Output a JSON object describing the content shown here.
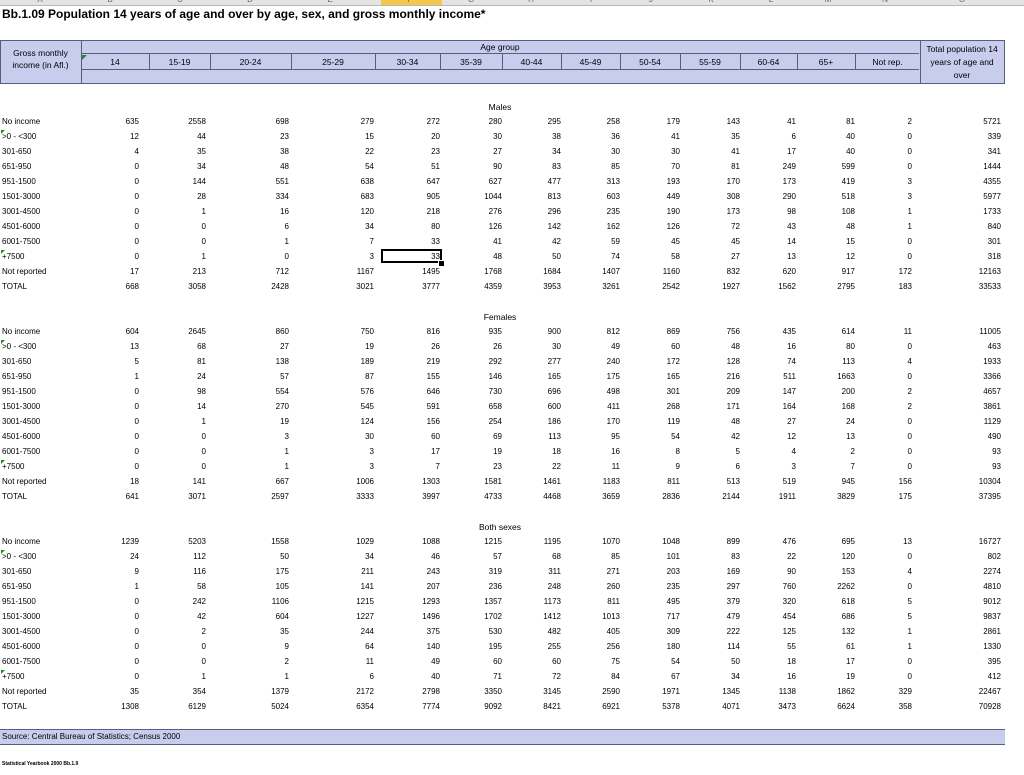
{
  "sheet": {
    "column_letters": [
      "A",
      "B",
      "C",
      "D",
      "E",
      "F",
      "G",
      "H",
      "I",
      "J",
      "K",
      "L",
      "M",
      "N",
      "O"
    ],
    "title": "Bb.1.09  Population 14 years of age and over by age, sex, and gross monthly income*"
  },
  "header": {
    "gross_label_1": "Gross monthly",
    "gross_label_2": "income (in Afl.)",
    "age_group": "Age group",
    "total_1": "Total population 14",
    "total_2": "years of age and",
    "total_3": "over",
    "ages": [
      "14",
      "15-19",
      "20-24",
      "25-29",
      "30-34",
      "35-39",
      "40-44",
      "45-49",
      "50-54",
      "55-59",
      "60-64",
      "65+",
      "Not rep."
    ]
  },
  "row_labels": [
    "No income",
    ">0 - <300",
    "301-650",
    "651-950",
    "951-1500",
    "1501-3000",
    "3001-4500",
    "4501-6000",
    "6001-7500",
    "+7500",
    "Not reported",
    "TOTAL"
  ],
  "sections": [
    {
      "title": "Males",
      "rows": [
        [
          "635",
          "2558",
          "698",
          "279",
          "272",
          "280",
          "295",
          "258",
          "179",
          "143",
          "41",
          "81",
          "2",
          "5721"
        ],
        [
          "12",
          "44",
          "23",
          "15",
          "20",
          "30",
          "38",
          "36",
          "41",
          "35",
          "6",
          "40",
          "0",
          "339"
        ],
        [
          "4",
          "35",
          "38",
          "22",
          "23",
          "27",
          "34",
          "30",
          "30",
          "41",
          "17",
          "40",
          "0",
          "341"
        ],
        [
          "0",
          "34",
          "48",
          "54",
          "51",
          "90",
          "83",
          "85",
          "70",
          "81",
          "249",
          "599",
          "0",
          "1444"
        ],
        [
          "0",
          "144",
          "551",
          "638",
          "647",
          "627",
          "477",
          "313",
          "193",
          "170",
          "173",
          "419",
          "3",
          "4355"
        ],
        [
          "0",
          "28",
          "334",
          "683",
          "905",
          "1044",
          "813",
          "603",
          "449",
          "308",
          "290",
          "518",
          "3",
          "5977"
        ],
        [
          "0",
          "1",
          "16",
          "120",
          "218",
          "276",
          "296",
          "235",
          "190",
          "173",
          "98",
          "108",
          "1",
          "1733"
        ],
        [
          "0",
          "0",
          "6",
          "34",
          "80",
          "126",
          "142",
          "162",
          "126",
          "72",
          "43",
          "48",
          "1",
          "840"
        ],
        [
          "0",
          "0",
          "1",
          "7",
          "33",
          "41",
          "42",
          "59",
          "45",
          "45",
          "14",
          "15",
          "0",
          "301"
        ],
        [
          "0",
          "1",
          "0",
          "3",
          "33",
          "48",
          "50",
          "74",
          "58",
          "27",
          "13",
          "12",
          "0",
          "318"
        ],
        [
          "17",
          "213",
          "712",
          "1167",
          "1495",
          "1768",
          "1684",
          "1407",
          "1160",
          "832",
          "620",
          "917",
          "172",
          "12163"
        ],
        [
          "668",
          "3058",
          "2428",
          "3021",
          "3777",
          "4359",
          "3953",
          "3261",
          "2542",
          "1927",
          "1562",
          "2795",
          "183",
          "33533"
        ]
      ]
    },
    {
      "title": "Females",
      "rows": [
        [
          "604",
          "2645",
          "860",
          "750",
          "816",
          "935",
          "900",
          "812",
          "869",
          "756",
          "435",
          "614",
          "11",
          "11005"
        ],
        [
          "13",
          "68",
          "27",
          "19",
          "26",
          "26",
          "30",
          "49",
          "60",
          "48",
          "16",
          "80",
          "0",
          "463"
        ],
        [
          "5",
          "81",
          "138",
          "189",
          "219",
          "292",
          "277",
          "240",
          "172",
          "128",
          "74",
          "113",
          "4",
          "1933"
        ],
        [
          "1",
          "24",
          "57",
          "87",
          "155",
          "146",
          "165",
          "175",
          "165",
          "216",
          "511",
          "1663",
          "0",
          "3366"
        ],
        [
          "0",
          "98",
          "554",
          "576",
          "646",
          "730",
          "696",
          "498",
          "301",
          "209",
          "147",
          "200",
          "2",
          "4657"
        ],
        [
          "0",
          "14",
          "270",
          "545",
          "591",
          "658",
          "600",
          "411",
          "268",
          "171",
          "164",
          "168",
          "2",
          "3861"
        ],
        [
          "0",
          "1",
          "19",
          "124",
          "156",
          "254",
          "186",
          "170",
          "119",
          "48",
          "27",
          "24",
          "0",
          "1129"
        ],
        [
          "0",
          "0",
          "3",
          "30",
          "60",
          "69",
          "113",
          "95",
          "54",
          "42",
          "12",
          "13",
          "0",
          "490"
        ],
        [
          "0",
          "0",
          "1",
          "3",
          "17",
          "19",
          "18",
          "16",
          "8",
          "5",
          "4",
          "2",
          "0",
          "93"
        ],
        [
          "0",
          "0",
          "1",
          "3",
          "7",
          "23",
          "22",
          "11",
          "9",
          "6",
          "3",
          "7",
          "0",
          "93"
        ],
        [
          "18",
          "141",
          "667",
          "1006",
          "1303",
          "1581",
          "1461",
          "1183",
          "811",
          "513",
          "519",
          "945",
          "156",
          "10304"
        ],
        [
          "641",
          "3071",
          "2597",
          "3333",
          "3997",
          "4733",
          "4468",
          "3659",
          "2836",
          "2144",
          "1911",
          "3829",
          "175",
          "37395"
        ]
      ]
    },
    {
      "title": "Both sexes",
      "rows": [
        [
          "1239",
          "5203",
          "1558",
          "1029",
          "1088",
          "1215",
          "1195",
          "1070",
          "1048",
          "899",
          "476",
          "695",
          "13",
          "16727"
        ],
        [
          "24",
          "112",
          "50",
          "34",
          "46",
          "57",
          "68",
          "85",
          "101",
          "83",
          "22",
          "120",
          "0",
          "802"
        ],
        [
          "9",
          "116",
          "175",
          "211",
          "243",
          "319",
          "311",
          "271",
          "203",
          "169",
          "90",
          "153",
          "4",
          "2274"
        ],
        [
          "1",
          "58",
          "105",
          "141",
          "207",
          "236",
          "248",
          "260",
          "235",
          "297",
          "760",
          "2262",
          "0",
          "4810"
        ],
        [
          "0",
          "242",
          "1106",
          "1215",
          "1293",
          "1357",
          "1173",
          "811",
          "495",
          "379",
          "320",
          "618",
          "5",
          "9012"
        ],
        [
          "0",
          "42",
          "604",
          "1227",
          "1496",
          "1702",
          "1412",
          "1013",
          "717",
          "479",
          "454",
          "686",
          "5",
          "9837"
        ],
        [
          "0",
          "2",
          "35",
          "244",
          "375",
          "530",
          "482",
          "405",
          "309",
          "222",
          "125",
          "132",
          "1",
          "2861"
        ],
        [
          "0",
          "0",
          "9",
          "64",
          "140",
          "195",
          "255",
          "256",
          "180",
          "114",
          "55",
          "61",
          "1",
          "1330"
        ],
        [
          "0",
          "0",
          "2",
          "11",
          "49",
          "60",
          "60",
          "75",
          "54",
          "50",
          "18",
          "17",
          "0",
          "395"
        ],
        [
          "0",
          "1",
          "1",
          "6",
          "40",
          "71",
          "72",
          "84",
          "67",
          "34",
          "16",
          "19",
          "0",
          "412"
        ],
        [
          "35",
          "354",
          "1379",
          "2172",
          "2798",
          "3350",
          "3145",
          "2590",
          "1971",
          "1345",
          "1138",
          "1862",
          "329",
          "22467"
        ],
        [
          "1308",
          "6129",
          "5024",
          "6354",
          "7774",
          "9092",
          "8421",
          "6921",
          "5378",
          "4071",
          "3473",
          "6624",
          "358",
          "70928"
        ]
      ]
    }
  ],
  "source": "Source: Central Bureau of Statistics; Census 2000",
  "footer": "Statistical Yearbook 2000 Bb.1.9"
}
